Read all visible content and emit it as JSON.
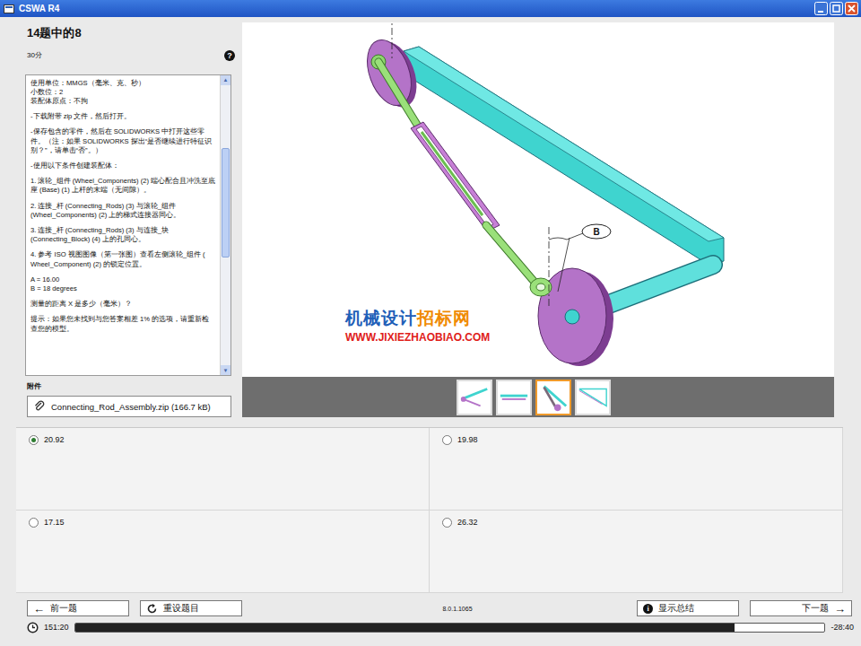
{
  "window": {
    "title": "CSWA R4"
  },
  "question": {
    "title": "14题中的8",
    "points": "30分",
    "help": "?"
  },
  "instructions": [
    [
      "使用单位：MMGS（毫米、克、秒）",
      "小数位：2",
      "装配体原点：不拘"
    ],
    [
      "-下载附带 zip 文件，然后打开。"
    ],
    [
      "-保存包含的零件，然后在 SOLIDWORKS 中打开这些零件。（注：如果 SOLIDWORKS 探出“是否继续进行特征识别？”，请单击“否”。）"
    ],
    [
      "-使用以下条件创建装配体："
    ],
    [
      "1. 滚轮_组件 (Wheel_Components) (2) 端心配合且冲洗至底座 (Base) (1) 上杆的末端（无间隙）。"
    ],
    [
      "2. 连接_杆 (Connecting_Rods) (3) 与滚轮_组件 (Wheel_Components) (2) 上的梯式连接器同心。"
    ],
    [
      "3. 连接_杆 (Connecting_Rods) (3) 与连接_块 (Connecting_Block) (4) 上的孔同心。"
    ],
    [
      "4. 参考 ISO 视图图像（第一张图）查看左侧滚轮_组件 ( Wheel_Component) (2) 的锁定位置。"
    ],
    [
      "A = 16.00",
      "B = 18 degrees"
    ],
    [
      "测量的距离 X 是多少（毫米）？"
    ],
    [
      "提示：如果您未找到与您答案相差 1% 的选项，请重新检查您的模型。"
    ]
  ],
  "attachments": {
    "label": "附件",
    "file": "Connecting_Rod_Assembly.zip (166.7 kB)"
  },
  "figure": {
    "callout": "B",
    "watermark": [
      {
        "text": "机械设计",
        "color": "#1f5fb8"
      },
      {
        "text": "招标网",
        "color": "#f08a00"
      }
    ],
    "watermark_url": "WWW.JIXIEZHAOBIAO.COM"
  },
  "thumbnails": [
    {
      "selected": false
    },
    {
      "selected": false
    },
    {
      "selected": true
    },
    {
      "selected": false
    }
  ],
  "options": [
    {
      "label": "20.92",
      "selected": true
    },
    {
      "label": "19.98",
      "selected": false
    },
    {
      "label": "17.15",
      "selected": false
    },
    {
      "label": "26.32",
      "selected": false
    }
  ],
  "nav": {
    "prev_icon": "←",
    "prev": "前一题",
    "reset": "重设题目",
    "version": "8.0.1.1065",
    "summary_icon": "i",
    "summary": "显示总结",
    "next": "下一题",
    "next_icon": "→"
  },
  "timer": {
    "elapsed": "151:20",
    "remaining": "-28:40",
    "level": 0.88
  }
}
